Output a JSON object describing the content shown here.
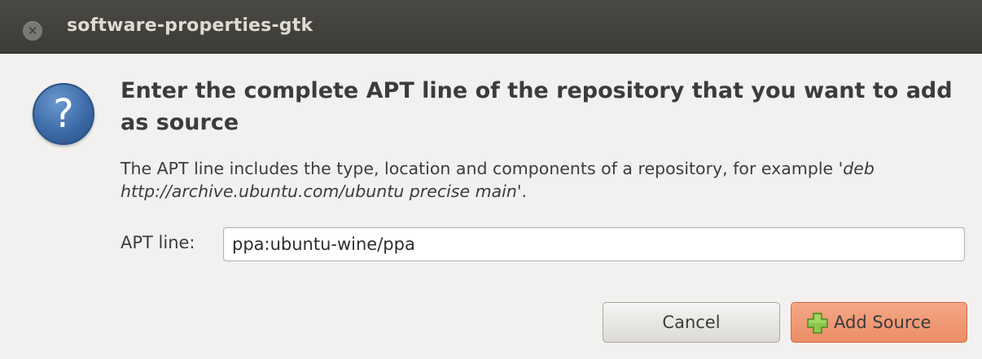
{
  "window": {
    "title": "software-properties-gtk"
  },
  "dialog": {
    "heading": "Enter the complete APT line of the repository that you want to add as source",
    "description_prefix": "The APT line includes the type, location and components of a repository, for example  '",
    "description_example": "deb http://archive.ubuntu.com/ubuntu precise main",
    "description_suffix": "'.",
    "apt_line_label": "APT line:",
    "apt_line_value": "ppa:ubuntu-wine/ppa"
  },
  "buttons": {
    "cancel_label": "Cancel",
    "add_label": "Add Source"
  },
  "icons": {
    "close": "close-icon",
    "dialog": "question-icon",
    "add": "plus-icon"
  },
  "colors": {
    "titlebar": "#3c3b37",
    "accent_button": "#eb8d66",
    "plus_green": "#7bc043"
  }
}
